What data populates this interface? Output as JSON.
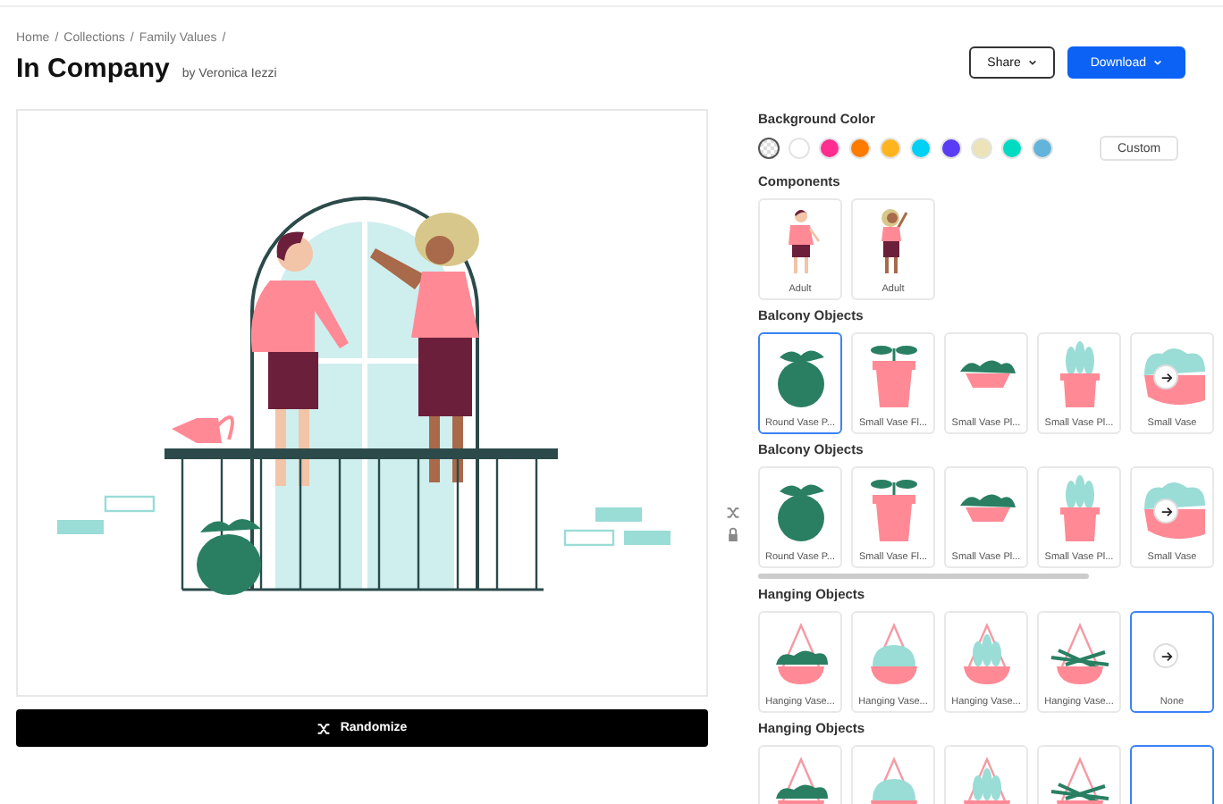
{
  "breadcrumb": {
    "items": [
      "Home",
      "Collections",
      "Family Values"
    ],
    "separator": "/"
  },
  "title": "In Company",
  "author": "by Veronica Iezzi",
  "actions": [
    {
      "label": "Share",
      "kind": "secondary"
    },
    {
      "label": "Download",
      "kind": "primary"
    }
  ],
  "preview": {
    "button": "Randomize"
  },
  "background_color": {
    "label": "Background Color",
    "custom_button": "Custom",
    "swatches": [
      {
        "kind": "transparent",
        "selected": true
      },
      {
        "kind": "solid",
        "color": "#ffffff",
        "selected": false
      },
      {
        "kind": "solid",
        "color": "#ff2d8f",
        "selected": false
      },
      {
        "kind": "solid",
        "color": "#ff7b00",
        "selected": false
      },
      {
        "kind": "solid",
        "color": "#ffb41f",
        "selected": false
      },
      {
        "kind": "solid",
        "color": "#00d0f4",
        "selected": false
      },
      {
        "kind": "solid",
        "color": "#5a3cf4",
        "selected": false
      },
      {
        "kind": "solid",
        "color": "#ece3b9",
        "selected": false
      },
      {
        "kind": "solid",
        "color": "#00dbc2",
        "selected": false
      },
      {
        "kind": "solid",
        "color": "#62b4da",
        "selected": false
      }
    ]
  },
  "sections": [
    {
      "title": "Components",
      "next_arrow": false,
      "scrollbar": false,
      "items": [
        {
          "kind": "man",
          "label": "Adult",
          "selected": false
        },
        {
          "kind": "woman",
          "label": "Adult",
          "selected": false
        }
      ]
    },
    {
      "title": "Balcony Objects",
      "next_arrow": true,
      "scrollbar": false,
      "items": [
        {
          "kind": "round-vase",
          "label": "Round Vase P...",
          "selected": true
        },
        {
          "kind": "flower-pot",
          "label": "Small Vase Fl...",
          "selected": false
        },
        {
          "kind": "trough",
          "label": "Small Vase Pl...",
          "selected": false
        },
        {
          "kind": "succulent",
          "label": "Small Vase Pl...",
          "selected": false
        },
        {
          "kind": "bush-pot",
          "label": "Small Vase",
          "selected": false
        }
      ]
    },
    {
      "title": "Balcony Objects",
      "next_arrow": true,
      "scrollbar": true,
      "items": [
        {
          "kind": "round-vase",
          "label": "Round Vase P...",
          "selected": false
        },
        {
          "kind": "flower-pot",
          "label": "Small Vase Fl...",
          "selected": false
        },
        {
          "kind": "trough",
          "label": "Small Vase Pl...",
          "selected": false
        },
        {
          "kind": "succulent",
          "label": "Small Vase Pl...",
          "selected": false
        },
        {
          "kind": "bush-pot",
          "label": "Small Vase",
          "selected": false
        }
      ]
    },
    {
      "title": "Hanging Objects",
      "next_arrow": true,
      "scrollbar": false,
      "items": [
        {
          "kind": "hanging-bush",
          "label": "Hanging Vase...",
          "selected": false
        },
        {
          "kind": "hanging-round",
          "label": "Hanging Vase...",
          "selected": false
        },
        {
          "kind": "hanging-succulent",
          "label": "Hanging Vase...",
          "selected": false
        },
        {
          "kind": "hanging-fern",
          "label": "Hanging Vase...",
          "selected": false
        },
        {
          "kind": "none",
          "label": "None",
          "selected": true
        }
      ]
    },
    {
      "title": "Hanging Objects",
      "next_arrow": false,
      "scrollbar": false,
      "items": [
        {
          "kind": "hanging-bush",
          "selected": false
        },
        {
          "kind": "hanging-round",
          "selected": false
        },
        {
          "kind": "hanging-succulent",
          "selected": false
        },
        {
          "kind": "hanging-fern",
          "selected": false
        },
        {
          "kind": "none",
          "selected": true
        }
      ]
    }
  ]
}
